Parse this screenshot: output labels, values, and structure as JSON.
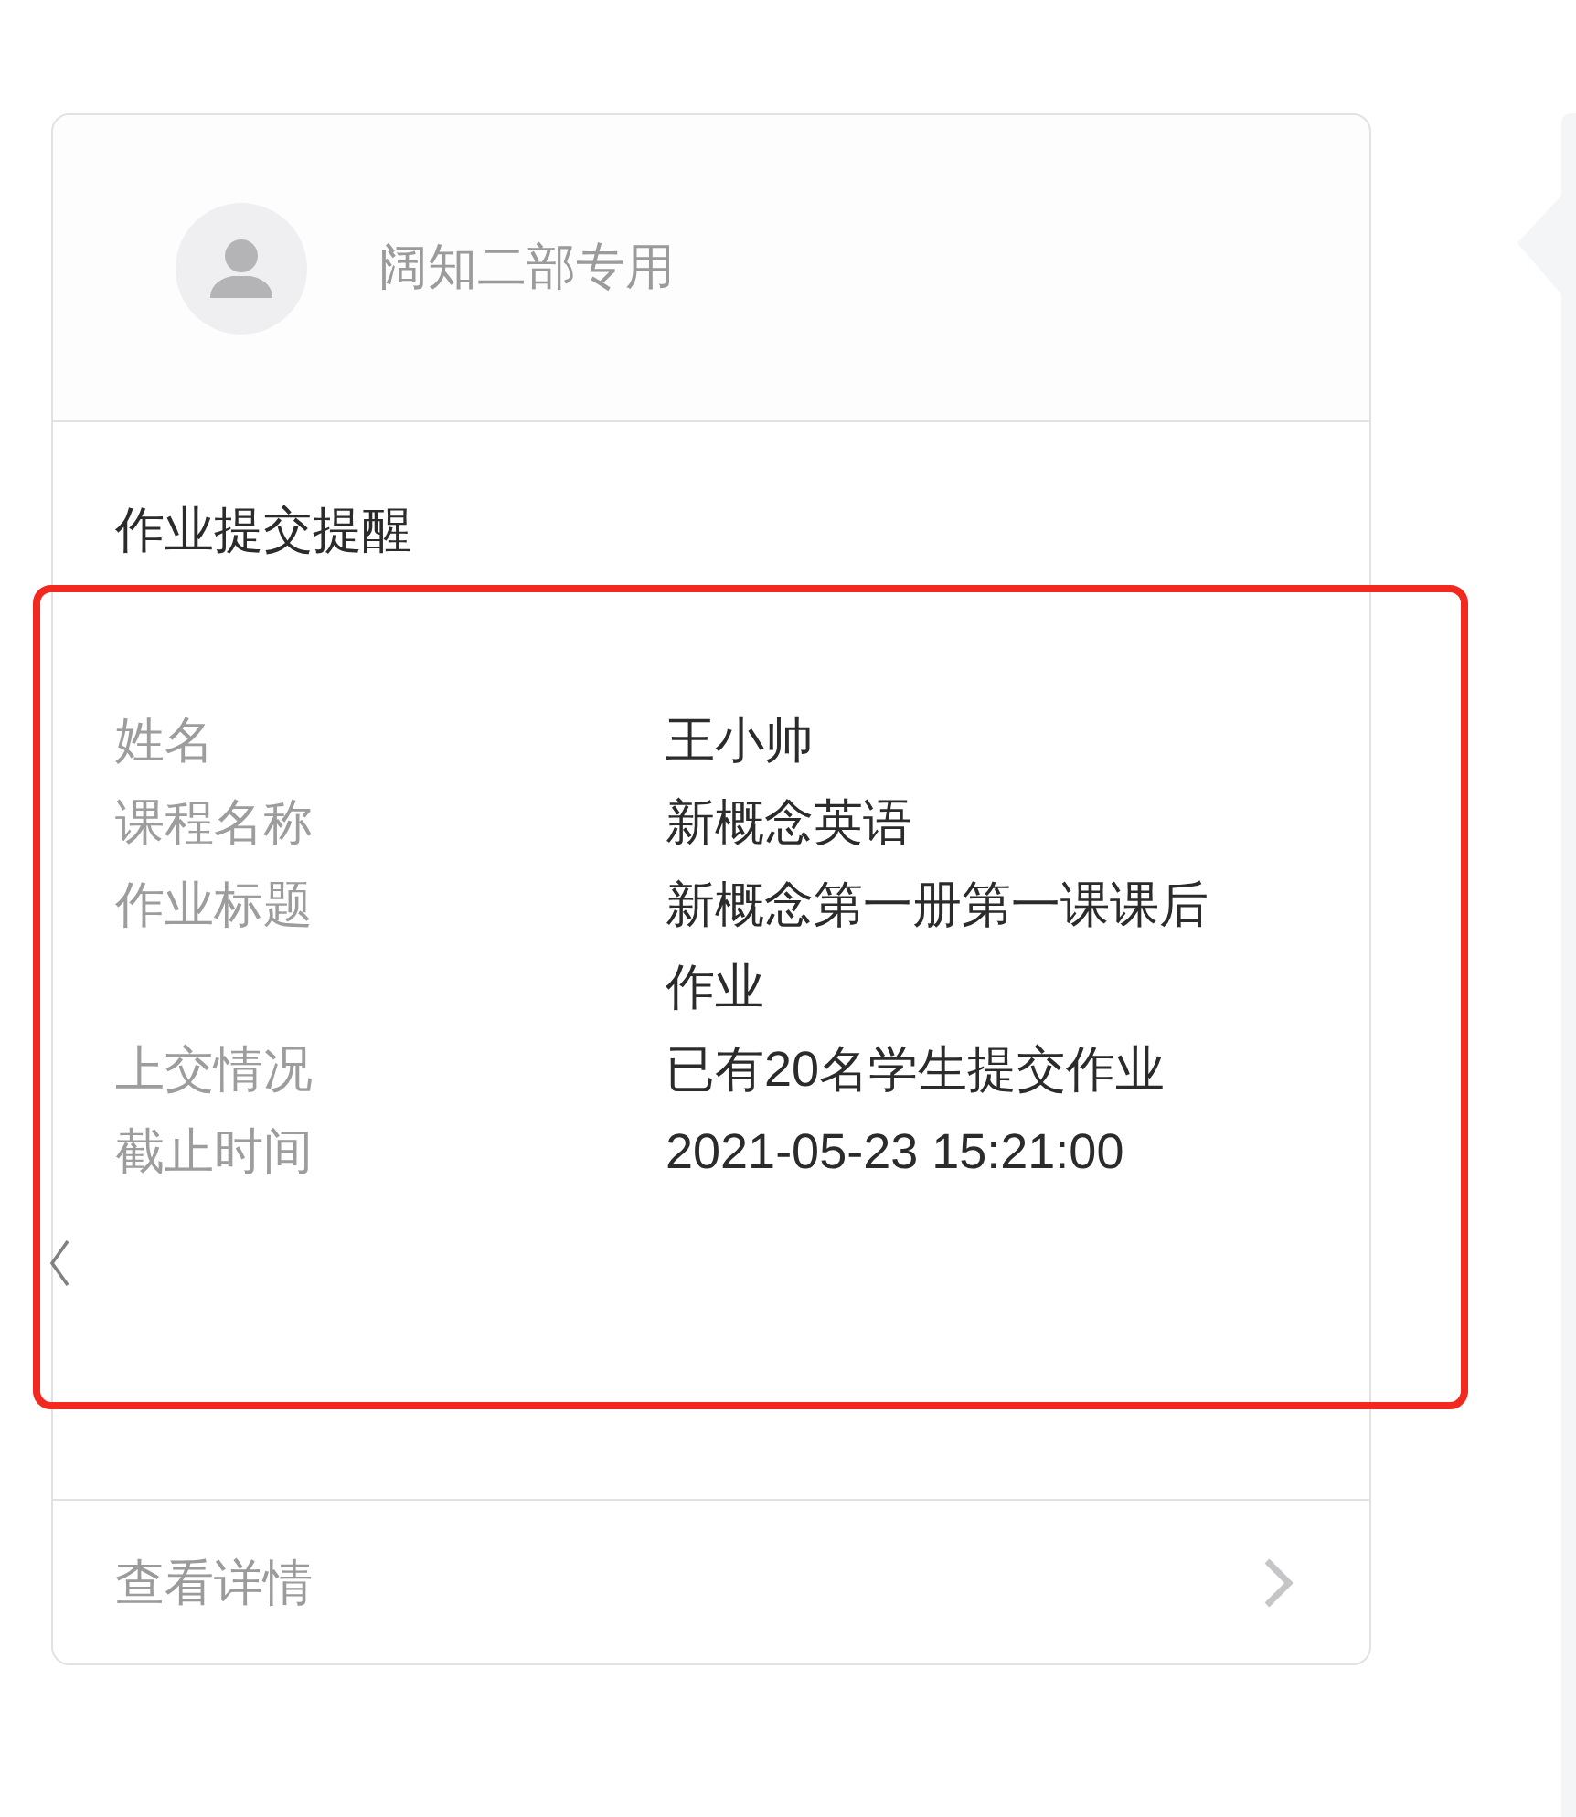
{
  "sender": {
    "name": "阔知二部专用"
  },
  "notice": {
    "title": "作业提交提醒",
    "fields": [
      {
        "label": "姓名",
        "value": "王小帅"
      },
      {
        "label": "课程名称",
        "value": "新概念英语"
      },
      {
        "label": "作业标题",
        "value": "新概念第一册第一课课后作业"
      },
      {
        "label": "上交情况",
        "value": "已有20名学生提交作业"
      },
      {
        "label": "截止时间",
        "value": "2021-05-23 15:21:00"
      }
    ]
  },
  "footer": {
    "link": "查看详情"
  }
}
